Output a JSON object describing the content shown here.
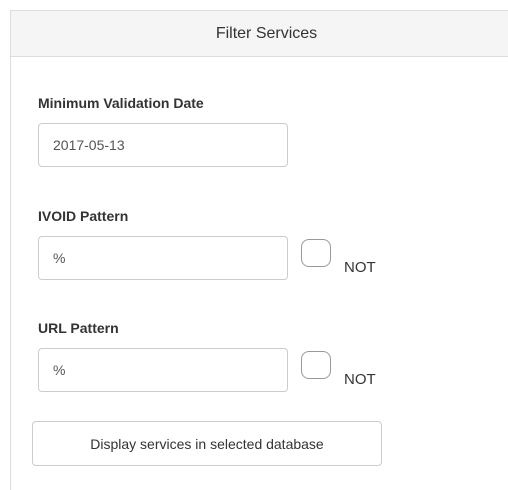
{
  "panel": {
    "title": "Filter Services"
  },
  "form": {
    "min_validation_date": {
      "label": "Minimum Validation Date",
      "value": "2017-05-13"
    },
    "ivoid_pattern": {
      "label": "IVOID Pattern",
      "value": "%",
      "not_checked": false,
      "not_label": "NOT"
    },
    "url_pattern": {
      "label": "URL Pattern",
      "value": "%",
      "not_checked": false,
      "not_label": "NOT"
    },
    "submit_label": "Display services in selected database"
  }
}
